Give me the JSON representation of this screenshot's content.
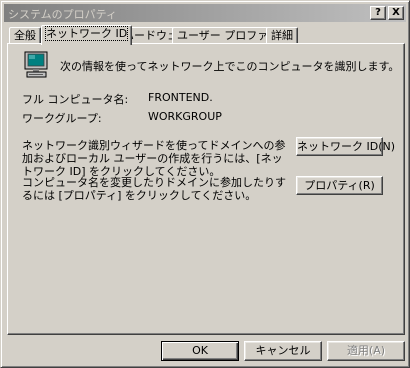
{
  "window": {
    "title": "システムのプロパティ",
    "help_btn": "?",
    "close_btn": "X"
  },
  "tabs": [
    {
      "label": "全般"
    },
    {
      "label": "ネットワーク ID"
    },
    {
      "label": "ハードウェア"
    },
    {
      "label": "ユーザー プロファイル"
    },
    {
      "label": "詳細"
    }
  ],
  "main": {
    "intro": "次の情報を使ってネットワーク上でこのコンピュータを識別します。",
    "full_name_label": "フル コンピュータ名:",
    "full_name_value": "FRONTEND.",
    "workgroup_label": "ワークグループ:",
    "workgroup_value": "WORKGROUP",
    "wizard_desc": "ネットワーク識別ウィザードを使ってドメインへの参加およびローカル ユーザーの作成を行うには、[ネットワーク ID] をクリックしてください。",
    "network_id_button": "ネットワーク ID(N)",
    "rename_desc": "コンピュータ名を変更したりドメインに参加したりするには [プロパティ] をクリックしてください。",
    "properties_button": "プロパティ(R)"
  },
  "footer": {
    "ok": "OK",
    "cancel": "キャンセル",
    "apply": "適用(A)"
  }
}
